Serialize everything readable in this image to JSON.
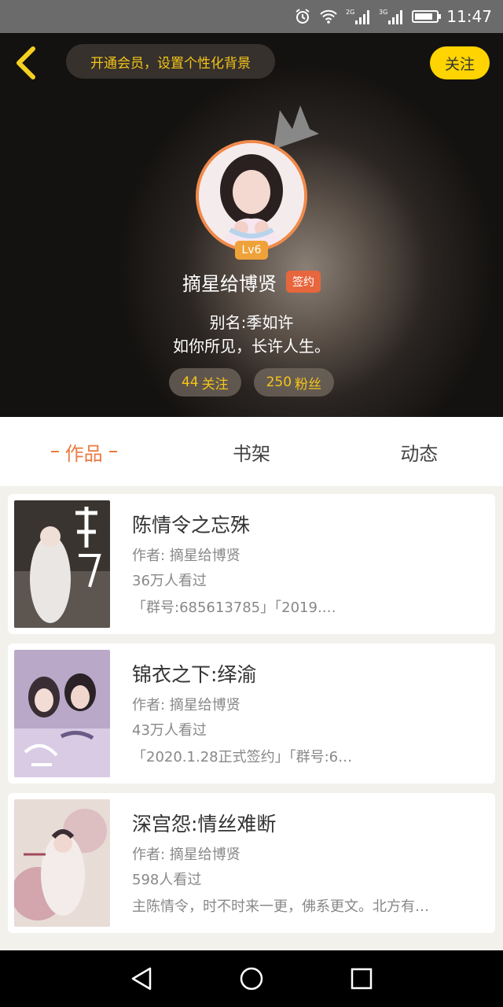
{
  "status_bar": {
    "net1": "2G",
    "net2": "3G",
    "time": "11:47",
    "battery_level": 0.85
  },
  "header": {
    "vip_prompt": "开通会员，设置个性化背景",
    "follow_label": "关注",
    "level": "Lv6",
    "username": "摘星给博贤",
    "signed_badge": "签约",
    "alias": "别名:季如许",
    "motto": "如你所见，长许人生。",
    "following_count": "44",
    "following_label": "关注",
    "fans_count": "250",
    "fans_label": "粉丝"
  },
  "tabs": [
    {
      "label": "作品",
      "active": true
    },
    {
      "label": "书架",
      "active": false
    },
    {
      "label": "动态",
      "active": false
    }
  ],
  "books": [
    {
      "title": "陈情令之忘殊",
      "author": "作者: 摘星给博贤",
      "views": "36万人看过",
      "tags": "「群号:685613785」「2019.…"
    },
    {
      "title": "锦衣之下:绎渝",
      "author": "作者: 摘星给博贤",
      "views": "43万人看过",
      "tags": "「2020.1.28正式签约」「群号:6…"
    },
    {
      "title": "深宫怨:情丝难断",
      "author": "作者: 摘星给博贤",
      "views": "598人看过",
      "tags": "主陈情令，时不时来一更，佛系更文。北方有…"
    }
  ],
  "colors": {
    "accent": "#ec7a40",
    "follow_yellow": "#ffd400",
    "stat_text": "#f5c518"
  },
  "icons": [
    "alarm-icon",
    "wifi-icon",
    "signal-icon",
    "battery-icon",
    "back-icon",
    "crown-icon",
    "nav-back-icon",
    "nav-home-icon",
    "nav-recents-icon"
  ]
}
